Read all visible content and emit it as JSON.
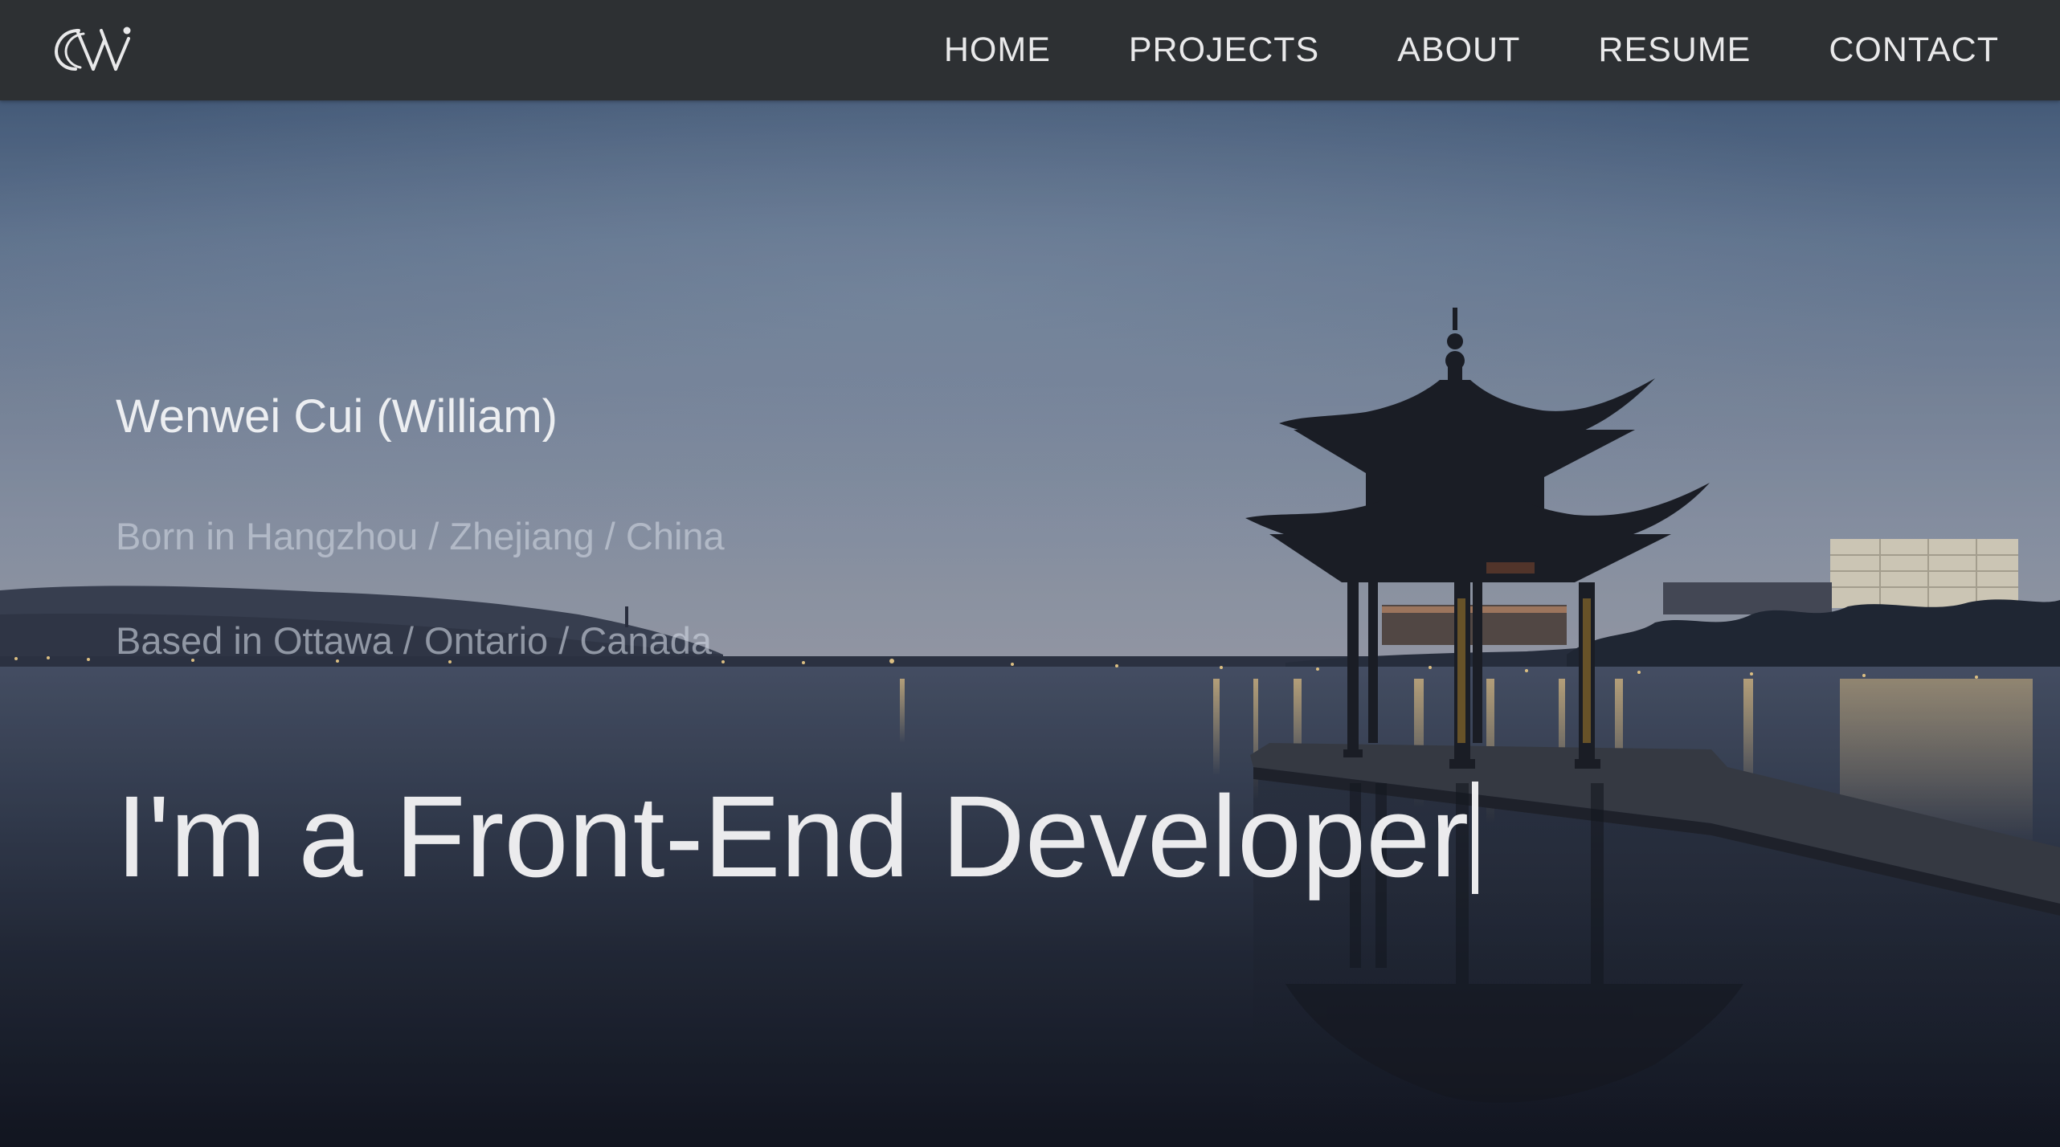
{
  "navbar": {
    "logo_alt": "CW",
    "links": [
      {
        "label": "HOME"
      },
      {
        "label": "PROJECTS"
      },
      {
        "label": "ABOUT"
      },
      {
        "label": "RESUME"
      },
      {
        "label": "CONTACT"
      }
    ]
  },
  "hero": {
    "name": "Wenwei Cui (William)",
    "born": "Born in Hangzhou / Zhejiang / China",
    "based": "Based in Ottawa / Ontario / Canada",
    "tagline_prefix": "I'm a",
    "tagline_role": "Front-End Developer"
  },
  "colors": {
    "navbar_bg": "#2d3033",
    "nav_text": "#e9e9ea",
    "hero_text": "#ebebed"
  },
  "icons": {
    "logo": "cw-monogram-logo",
    "cursor": "typing-cursor"
  }
}
